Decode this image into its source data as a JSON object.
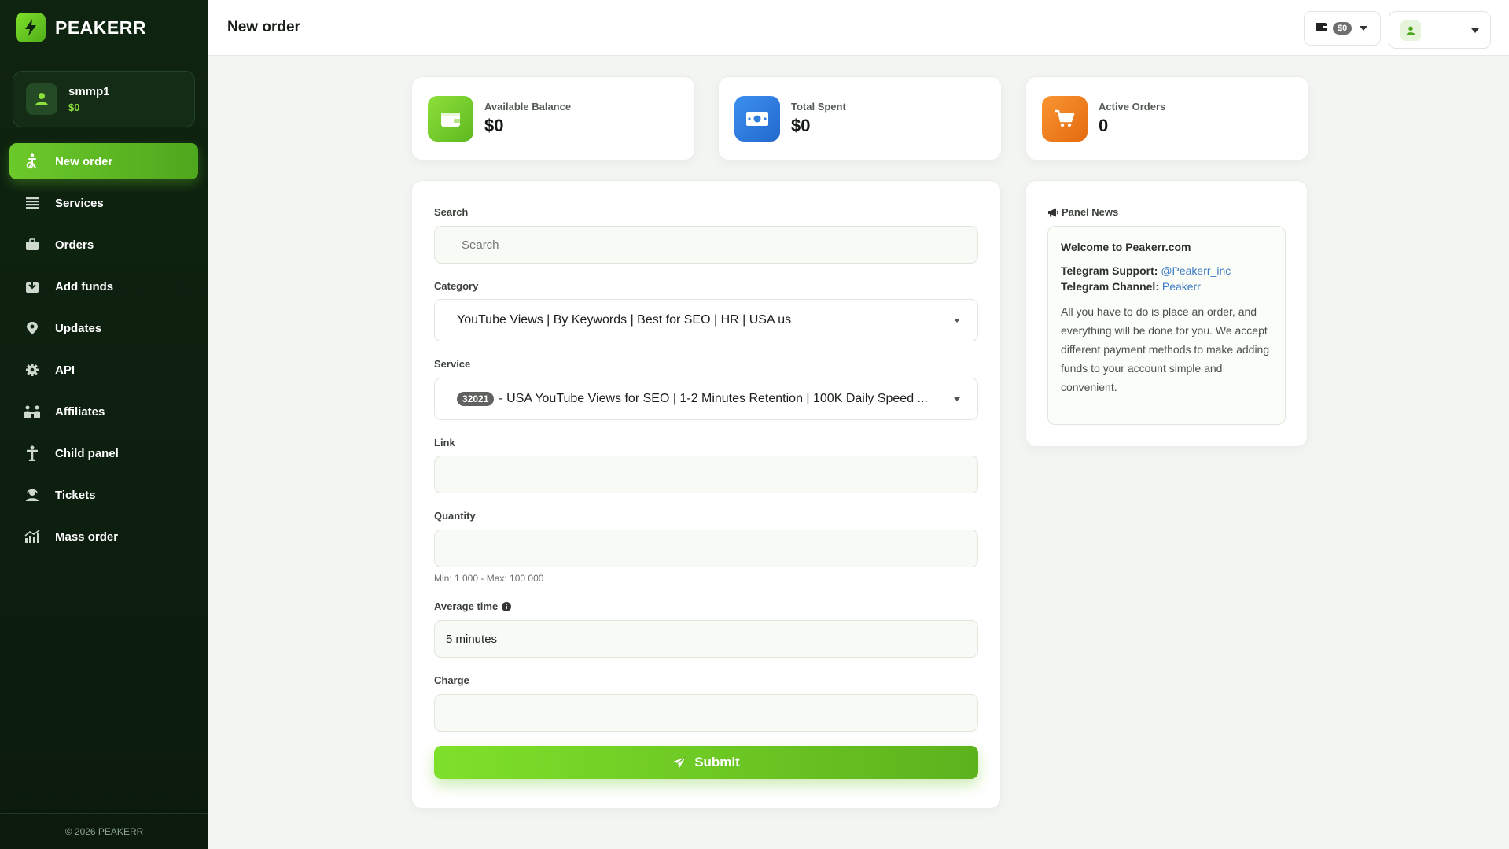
{
  "brand": {
    "name": "PEAKERR"
  },
  "user": {
    "name": "smmp1",
    "balance": "$0"
  },
  "nav": [
    {
      "label": "New order",
      "icon": "accessibility-icon"
    },
    {
      "label": "Services",
      "icon": "list-icon"
    },
    {
      "label": "Orders",
      "icon": "briefcase-icon"
    },
    {
      "label": "Add funds",
      "icon": "money-download-icon"
    },
    {
      "label": "Updates",
      "icon": "location-pin-icon"
    },
    {
      "label": "API",
      "icon": "gear-icon"
    },
    {
      "label": "Affiliates",
      "icon": "people-icon"
    },
    {
      "label": "Child panel",
      "icon": "child-icon"
    },
    {
      "label": "Tickets",
      "icon": "support-agent-icon"
    },
    {
      "label": "Mass order",
      "icon": "chart-icon"
    }
  ],
  "footer": "© 2026 PEAKERR",
  "header": {
    "title": "New order",
    "balance_pill": "$0"
  },
  "stats": [
    {
      "label": "Available Balance",
      "value": "$0",
      "color": "#6cc92a"
    },
    {
      "label": "Total Spent",
      "value": "$0",
      "color": "#2f7ddd"
    },
    {
      "label": "Active Orders",
      "value": "0",
      "color": "#f07d1c"
    }
  ],
  "form": {
    "search_label": "Search",
    "search_placeholder": "Search",
    "category_label": "Category",
    "category_value": "YouTube Views | By Keywords | Best for SEO | HR | USA us",
    "service_label": "Service",
    "service_id": "32021",
    "service_value": "- USA YouTube Views for SEO | 1-2 Minutes Retention | 100K Daily Speed ...",
    "link_label": "Link",
    "quantity_label": "Quantity",
    "quantity_hint": "Min: 1 000 - Max: 100 000",
    "avg_time_label": "Average time",
    "avg_time_value": "5 minutes",
    "charge_label": "Charge",
    "submit_label": "Submit"
  },
  "news": {
    "title": "Panel News",
    "heading": "Welcome to Peakerr.com",
    "support_label": "Telegram Support:",
    "support_value": "@Peakerr_inc",
    "channel_label": "Telegram Channel:",
    "channel_value": "Peakerr",
    "body": "All you have to do is place an order, and everything will be done for you. We accept different payment methods to make adding funds to your account simple and convenient."
  },
  "colors": {
    "accent": "#6cc92a",
    "sidebar": "#0f2410"
  }
}
